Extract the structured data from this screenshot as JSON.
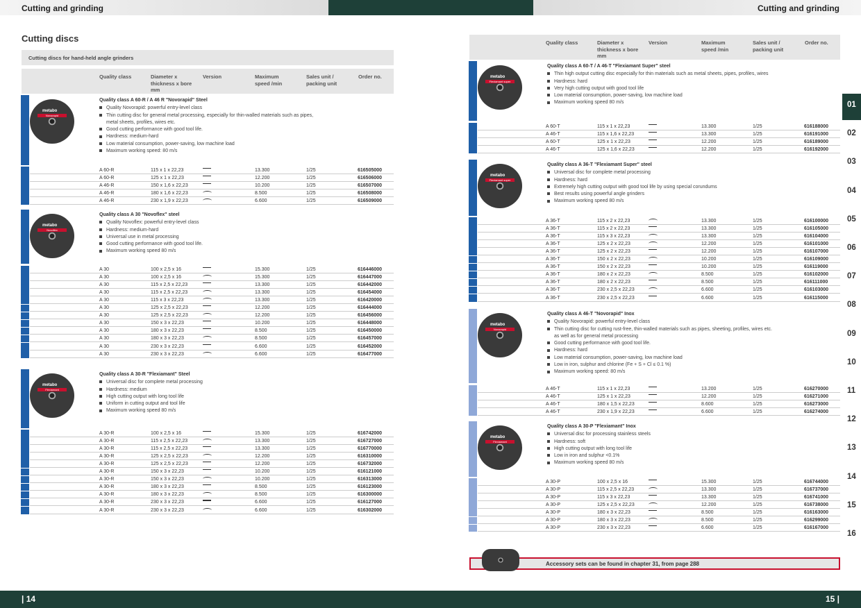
{
  "header": {
    "left_title": "Cutting and grinding",
    "right_title": "Cutting and grinding"
  },
  "footer": {
    "left_page": "| 14",
    "right_page": "15 |"
  },
  "section_title": "Cutting discs",
  "band_title": "Cutting discs for hand-held angle grinders",
  "columns": {
    "quality": "Quality class",
    "diameter": "Diameter x thickness x bore mm",
    "version": "Version",
    "speed": "Maximum speed /min",
    "sales": "Sales unit / packing unit",
    "order": "Order no."
  },
  "disc_logo": "metabo",
  "chapters": [
    "01",
    "02",
    "03",
    "04",
    "05",
    "06",
    "07",
    "08",
    "09",
    "10",
    "11",
    "12",
    "13",
    "14",
    "15",
    "16"
  ],
  "accessory_note": "Accessory sets can be found in chapter 31, from page 288",
  "colors": {
    "dark_green": "#1e4038",
    "blue_steel": "#1f5fa8",
    "light_inox": "#8fa8d8",
    "accent_red": "#c8102e"
  },
  "left_blocks": [
    {
      "title": "Quality class A 60-R / A 46 R \"Novorapid\" Steel",
      "label": "Novorapid",
      "bullets": [
        "Quality Novorapid: powerful entry-level class",
        "Thin cutting disc for general metal processing, especially for thin-walled materials such as pipes,",
        "metal sheets, profiles, wires etc.",
        "Good cutting performance with good tool life.",
        "Hardness: medium-hard",
        "Low material consumption, power-saving, low machine load",
        "Maximum working speed: 80 m/s"
      ],
      "rows": [
        [
          "A 60-R",
          "115 x 1 x 22,23",
          "flat",
          "13.300",
          "1/25",
          "616505000"
        ],
        [
          "A 60-R",
          "125 x 1 x 22,23",
          "flat",
          "12.200",
          "1/25",
          "616506000"
        ],
        [
          "A 46-R",
          "150 x 1,6 x 22,23",
          "flat",
          "10.200",
          "1/25",
          "616507000"
        ],
        [
          "A 46-R",
          "180 x 1,6 x 22,23",
          "curved",
          "8.500",
          "1/25",
          "616508000"
        ],
        [
          "A 46-R",
          "230 x 1,9 x 22,23",
          "curved",
          "6.600",
          "1/25",
          "616509000"
        ]
      ]
    },
    {
      "title": "Quality class A 30 \"Novoflex\" steel",
      "label": "Novoflex",
      "bullets": [
        "Quality Novoflex: powerful entry-level class",
        "Hardness: medium-hard",
        "Universal use in metal processing",
        "Good cutting performance with good tool life.",
        "Maximum working speed 80 m/s"
      ],
      "rows": [
        [
          "A 30",
          "100 x 2,5 x 16",
          "flat",
          "15.300",
          "1/25",
          "616446000"
        ],
        [
          "A 30",
          "100 x 2,5 x 16",
          "curved",
          "15.300",
          "1/25",
          "616447000"
        ],
        [
          "A 30",
          "115 x 2,5 x 22,23",
          "flat",
          "13.300",
          "1/25",
          "616442000"
        ],
        [
          "A 30",
          "115 x 2,5 x 22,23",
          "curved",
          "13.300",
          "1/25",
          "616454000"
        ],
        [
          "A 30",
          "115 x 3 x 22,23",
          "curved",
          "13.300",
          "1/25",
          "616420000"
        ],
        [
          "A 30",
          "125 x 2,5 x 22,23",
          "flat",
          "12.200",
          "1/25",
          "616444000"
        ],
        [
          "A 30",
          "125 x 2,5 x 22,23",
          "curved",
          "12.200",
          "1/25",
          "616456000"
        ],
        [
          "A 30",
          "150 x 3 x 22,23",
          "flat",
          "10.200",
          "1/25",
          "616448000"
        ],
        [
          "A 30",
          "180 x 3 x 22,23",
          "flat",
          "8.500",
          "1/25",
          "616450000"
        ],
        [
          "A 30",
          "180 x 3 x 22,23",
          "curved",
          "8.500",
          "1/25",
          "616457000"
        ],
        [
          "A 30",
          "230 x 3 x 22,23",
          "flat",
          "6.600",
          "1/25",
          "616452000"
        ],
        [
          "A 30",
          "230 x 3 x 22,23",
          "curved",
          "6.600",
          "1/25",
          "616477000"
        ]
      ]
    },
    {
      "title": "Quality class A 30-R \"Flexiamant\" Steel",
      "label": "Flexiamant",
      "bullets": [
        "Universal disc for complete metal processing",
        "Hardness: medium",
        "High cutting output with long tool life",
        "Uniform in cutting output and tool life",
        "Maximum working speed 80 m/s"
      ],
      "rows": [
        [
          "A 30-R",
          "100 x 2,5 x 16",
          "flat",
          "15.300",
          "1/25",
          "616742000"
        ],
        [
          "A 30-R",
          "115 x 2,5 x 22,23",
          "curved",
          "13.300",
          "1/25",
          "616727000"
        ],
        [
          "A 30-R",
          "115 x 2,5 x 22,23",
          "flat",
          "13.300",
          "1/25",
          "616770000"
        ],
        [
          "A 30-R",
          "125 x 2,5 x 22,23",
          "curved",
          "12.200",
          "1/25",
          "616310000"
        ],
        [
          "A 30-R",
          "125 x 2,5 x 22,23",
          "flat",
          "12.200",
          "1/25",
          "616732000"
        ],
        [
          "A 30-R",
          "150 x 3 x 22,23",
          "flat",
          "10.200",
          "1/25",
          "616121000"
        ],
        [
          "A 30-R",
          "150 x 3 x 22,23",
          "curved",
          "10.200",
          "1/25",
          "616313000"
        ],
        [
          "A 30-R",
          "180 x 3 x 22,23",
          "flat",
          "8.500",
          "1/25",
          "616123000"
        ],
        [
          "A 30-R",
          "180 x 3 x 22,23",
          "curved",
          "8.500",
          "1/25",
          "616300000"
        ],
        [
          "A 30-R",
          "230 x 3 x 22,23",
          "flat",
          "6.600",
          "1/25",
          "616127000"
        ],
        [
          "A 30-R",
          "230 x 3 x 22,23",
          "curved",
          "6.600",
          "1/25",
          "616302000"
        ]
      ]
    }
  ],
  "right_blocks": [
    {
      "title": "Quality class A 60-T / A 46-T \"Flexiamant Super\" steel",
      "label": "Flexiamant super",
      "bullets": [
        "Thin high output cutting disc especially for thin materials such as metal sheets, pipes, profiles, wires",
        "Hardness: hard",
        "Very high cutting output with good tool life",
        "Low material consumption, power-saving, low machine load",
        "Maximum working speed 80 m/s"
      ],
      "rows": [
        [
          "A 60-T",
          "115 x 1 x 22,23",
          "flat",
          "13.300",
          "1/25",
          "616188000"
        ],
        [
          "A 46-T",
          "115 x 1,6 x 22,23",
          "flat",
          "13.300",
          "1/25",
          "616191000"
        ],
        [
          "A 60-T",
          "125 x 1 x 22,23",
          "flat",
          "12.200",
          "1/25",
          "616189000"
        ],
        [
          "A 46-T",
          "125 x 1,6 x 22,23",
          "flat",
          "12.200",
          "1/25",
          "616192000"
        ]
      ]
    },
    {
      "title": "Quality class A 36-T \"Flexiamant Super\" steel",
      "label": "Flexiamant super",
      "bullets": [
        "Universal disc for complete metal processing",
        "Hardness: hard",
        "Extremely high cutting output with good tool life by using special corundums",
        "Best results using powerful angle grinders",
        "Maximum working speed 80 m/s"
      ],
      "rows": [
        [
          "A 36-T",
          "115 x 2 x 22,23",
          "curved",
          "13.300",
          "1/25",
          "616100000"
        ],
        [
          "A 36-T",
          "115 x 2 x 22,23",
          "flat",
          "13.300",
          "1/25",
          "616105000"
        ],
        [
          "A 36-T",
          "115 x 3 x 22,23",
          "curved",
          "13.300",
          "1/25",
          "616104000"
        ],
        [
          "A 36-T",
          "125 x 2 x 22,23",
          "curved",
          "12.200",
          "1/25",
          "616101000"
        ],
        [
          "A 36-T",
          "125 x 2 x 22,23",
          "flat",
          "12.200",
          "1/25",
          "616107000"
        ],
        [
          "A 36-T",
          "150 x 2 x 22,23",
          "curved",
          "10.200",
          "1/25",
          "616109000"
        ],
        [
          "A 36-T",
          "150 x 2 x 22,23",
          "flat",
          "10.200",
          "1/25",
          "616119000"
        ],
        [
          "A 36-T",
          "180 x 2 x 22,23",
          "curved",
          "8.500",
          "1/25",
          "616102000"
        ],
        [
          "A 36-T",
          "180 x 2 x 22,23",
          "flat",
          "8.500",
          "1/25",
          "616111000"
        ],
        [
          "A 36-T",
          "230 x 2,5 x 22,23",
          "curved",
          "6.600",
          "1/25",
          "616103000"
        ],
        [
          "A 36-T",
          "230 x 2,5 x 22,23",
          "flat",
          "6.600",
          "1/25",
          "616115000"
        ]
      ]
    },
    {
      "title": "Quality class A 46-T \"Novorapid\" Inox",
      "label": "Novorapid",
      "bullets": [
        "Quality Novorapid: powerful entry-level class",
        "Thin cutting disc for cutting rust-free, thin-walled materials such as pipes, sheeting, profiles, wires etc.",
        "as well as for general metal processing",
        "Good cutting performance with good tool life.",
        "Hardness: hard",
        "Low material consumption, power-saving, low machine load",
        "Low in iron, sulphur and chlorine (Fe + S + Cl ≤ 0.1 %)",
        "Maximum working speed: 80 m/s"
      ],
      "rows": [
        [
          "A 46-T",
          "115 x 1 x 22,23",
          "flat",
          "13.200",
          "1/25",
          "616270000"
        ],
        [
          "A 46-T",
          "125 x 1 x 22,23",
          "flat",
          "12.200",
          "1/25",
          "616271000"
        ],
        [
          "A 46-T",
          "180 x 1,5 x 22,23",
          "flat",
          "8.600",
          "1/25",
          "616273000"
        ],
        [
          "A 46-T",
          "230 x 1,9 x 22,23",
          "flat",
          "6.600",
          "1/25",
          "616274000"
        ]
      ]
    },
    {
      "title": "Quality class A 30-P \"Flexiamant\" Inox",
      "label": "Flexiamant",
      "bullets": [
        "Universal disc for processing stainless steels",
        "Hardness: soft",
        "High cutting output with long tool life",
        "Low in iron and sulphur <0.1%",
        "Maximum working speed 80 m/s"
      ],
      "rows": [
        [
          "A 30-P",
          "100 x 2,5 x 16",
          "flat",
          "15.300",
          "1/25",
          "616744000"
        ],
        [
          "A 30-P",
          "115 x 2,5 x 22,23",
          "curved",
          "13.300",
          "1/25",
          "616737000"
        ],
        [
          "A 30-P",
          "115 x 3 x 22,23",
          "flat",
          "13.300",
          "1/25",
          "616741000"
        ],
        [
          "A 30-P",
          "125 x 2,5 x 22,23",
          "curved",
          "12.200",
          "1/25",
          "616738000"
        ],
        [
          "A 30-P",
          "180 x 3 x 22,23",
          "flat",
          "8.500",
          "1/25",
          "616163000"
        ],
        [
          "A 30-P",
          "180 x 3 x 22,23",
          "curved",
          "8.500",
          "1/25",
          "616299000"
        ],
        [
          "A 30-P",
          "230 x 3 x 22,23",
          "flat",
          "6.600",
          "1/25",
          "616167000"
        ]
      ]
    }
  ]
}
